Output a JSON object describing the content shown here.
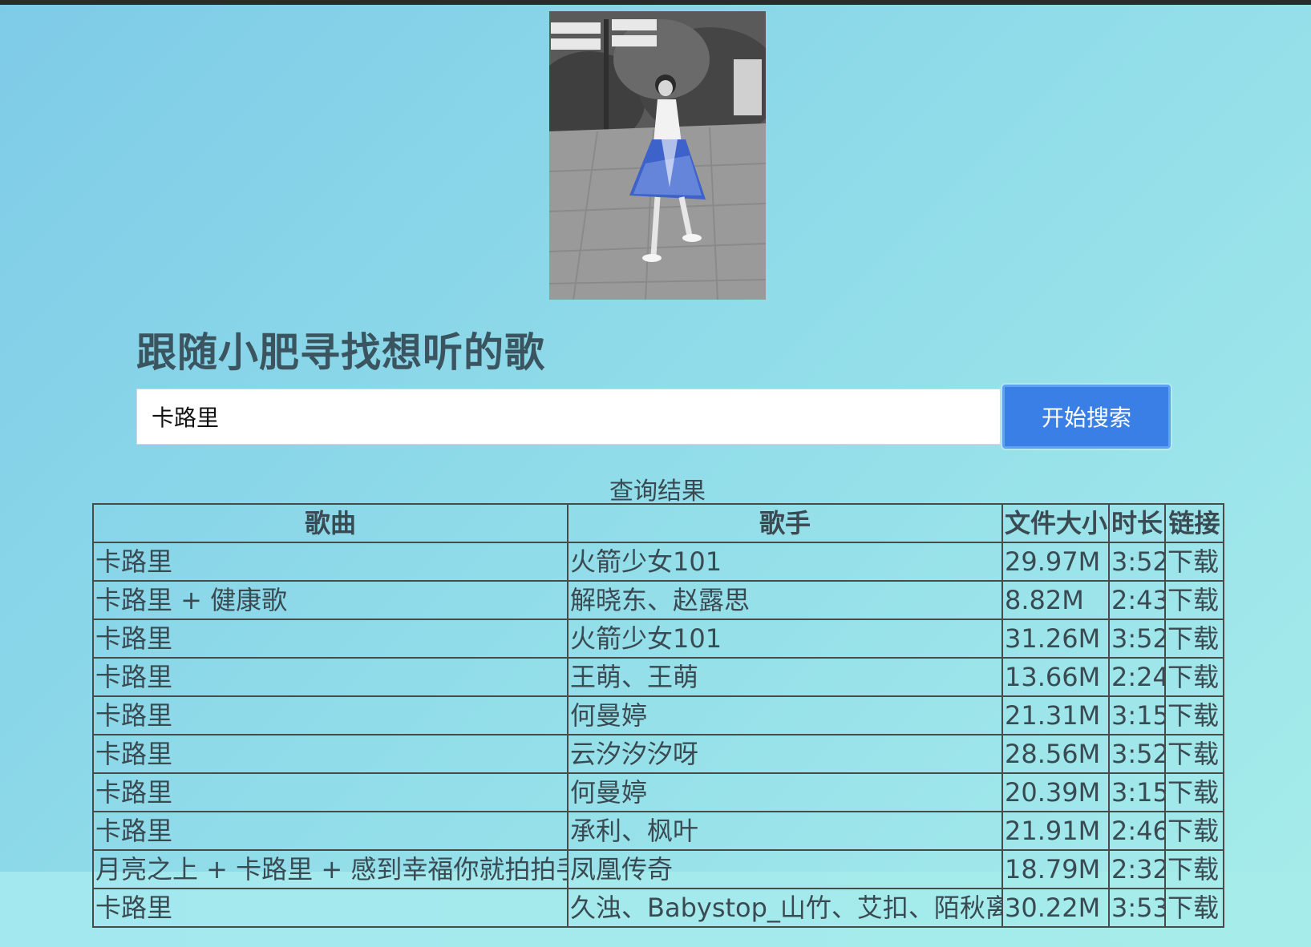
{
  "header": {
    "title": "跟随小肥寻找想听的歌",
    "photo": "girl-photo"
  },
  "search": {
    "value": "卡路里",
    "button_label": "开始搜索"
  },
  "results": {
    "caption": "查询结果",
    "columns": [
      "歌曲",
      "歌手",
      "文件大小",
      "时长",
      "链接"
    ],
    "rows": [
      {
        "song": "卡路里",
        "artist": "火箭少女101",
        "size": "29.97M",
        "duration": "3:52",
        "link": "下载"
      },
      {
        "song": "卡路里 + 健康歌",
        "artist": "解晓东、赵露思",
        "size": "8.82M",
        "duration": "2:43",
        "link": "下载"
      },
      {
        "song": "卡路里",
        "artist": "火箭少女101",
        "size": "31.26M",
        "duration": "3:52",
        "link": "下载"
      },
      {
        "song": "卡路里",
        "artist": "王萌、王萌",
        "size": "13.66M",
        "duration": "2:24",
        "link": "下载"
      },
      {
        "song": "卡路里",
        "artist": "何曼婷",
        "size": "21.31M",
        "duration": "3:15",
        "link": "下载"
      },
      {
        "song": "卡路里",
        "artist": "云汐汐汐呀",
        "size": "28.56M",
        "duration": "3:52",
        "link": "下载"
      },
      {
        "song": "卡路里",
        "artist": "何曼婷",
        "size": "20.39M",
        "duration": "3:15",
        "link": "下载"
      },
      {
        "song": "卡路里",
        "artist": "承利、枫叶",
        "size": "21.91M",
        "duration": "2:46",
        "link": "下载"
      },
      {
        "song": "月亮之上 + 卡路里 + 感到幸福你就拍拍手",
        "artist": "凤凰传奇",
        "size": "18.79M",
        "duration": "2:32",
        "link": "下载"
      },
      {
        "song": "卡路里",
        "artist": "久浊、Babystop_山竹、艾扣、陌秋离",
        "size": "30.22M",
        "duration": "3:53",
        "link": "下载"
      }
    ]
  }
}
